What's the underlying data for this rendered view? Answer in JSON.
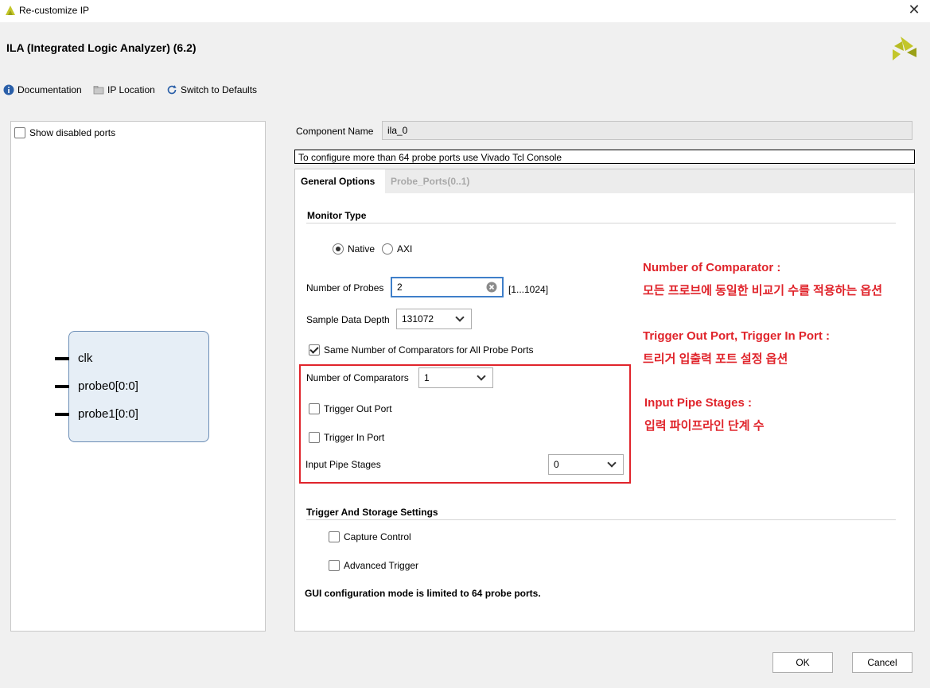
{
  "window": {
    "title": "Re-customize IP",
    "close_icon": "close-icon"
  },
  "header": {
    "title": "ILA (Integrated Logic Analyzer) (6.2)"
  },
  "toolbar": {
    "documentation": "Documentation",
    "ip_location": "IP Location",
    "switch_defaults": "Switch to Defaults"
  },
  "left_panel": {
    "show_disabled_ports": "Show disabled ports",
    "ports": [
      "clk",
      "probe0[0:0]",
      "probe1[0:0]"
    ]
  },
  "component": {
    "label": "Component Name",
    "value": "ila_0"
  },
  "info_message": "To configure more than 64 probe ports use Vivado Tcl Console",
  "tabs": {
    "general": "General Options",
    "probe_ports": "Probe_Ports(0..1)"
  },
  "general": {
    "monitor_type_title": "Monitor Type",
    "native_label": "Native",
    "axi_label": "AXI",
    "num_probes_label": "Number of Probes",
    "num_probes_value": "2",
    "num_probes_range": "[1...1024]",
    "sample_depth_label": "Sample Data Depth",
    "sample_depth_value": "131072",
    "same_comparators_label": "Same Number of Comparators for All Probe Ports",
    "num_comparators_label": "Number of Comparators",
    "num_comparators_value": "1",
    "trigger_out_label": "Trigger Out Port",
    "trigger_in_label": "Trigger In Port",
    "input_pipe_label": "Input Pipe Stages",
    "input_pipe_value": "0",
    "trigger_storage_title": "Trigger And Storage Settings",
    "capture_control_label": "Capture Control",
    "advanced_trigger_label": "Advanced Trigger",
    "gui_note": "GUI configuration mode is limited to 64 probe ports."
  },
  "annotations": {
    "a1_title": "Number of Comparator :",
    "a1_desc": "모든 프로브에 동일한 비교기 수를 적용하는 옵션",
    "a2_title": "Trigger Out Port, Trigger In Port :",
    "a2_desc": "트리거 입출력 포트 설정 옵션",
    "a3_title": "Input Pipe Stages :",
    "a3_desc": "입력 파이프라인 단계 수"
  },
  "buttons": {
    "ok": "OK",
    "cancel": "Cancel"
  },
  "colors": {
    "annotation_red": "#e0242b",
    "xilinx_logo": "#c3c62a"
  }
}
